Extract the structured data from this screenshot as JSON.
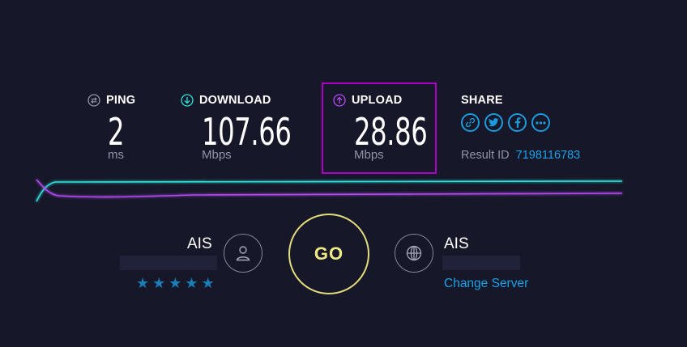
{
  "metrics": {
    "ping": {
      "label": "PING",
      "value": "2",
      "unit": "ms"
    },
    "download": {
      "label": "DOWNLOAD",
      "value": "107.66",
      "unit": "Mbps"
    },
    "upload": {
      "label": "UPLOAD",
      "value": "28.86",
      "unit": "Mbps"
    }
  },
  "share": {
    "label": "SHARE",
    "icons": [
      "link-icon",
      "twitter-icon",
      "facebook-icon",
      "more-icon"
    ],
    "result_label": "Result ID",
    "result_id": "7198116783"
  },
  "client": {
    "isp": "AIS",
    "rating": 5,
    "rating_max": 5,
    "icon": "user-icon"
  },
  "go_button": {
    "label": "GO"
  },
  "server": {
    "name": "AIS",
    "change_label": "Change Server",
    "icon": "globe-icon"
  },
  "colors": {
    "background": "#161729",
    "ping_icon": "#9193a8",
    "download_accent": "#2de0d8",
    "upload_accent": "#b44af0",
    "link": "#1aa3e8",
    "go": "#e3dd7a",
    "highlight_box": "#b000c8"
  }
}
